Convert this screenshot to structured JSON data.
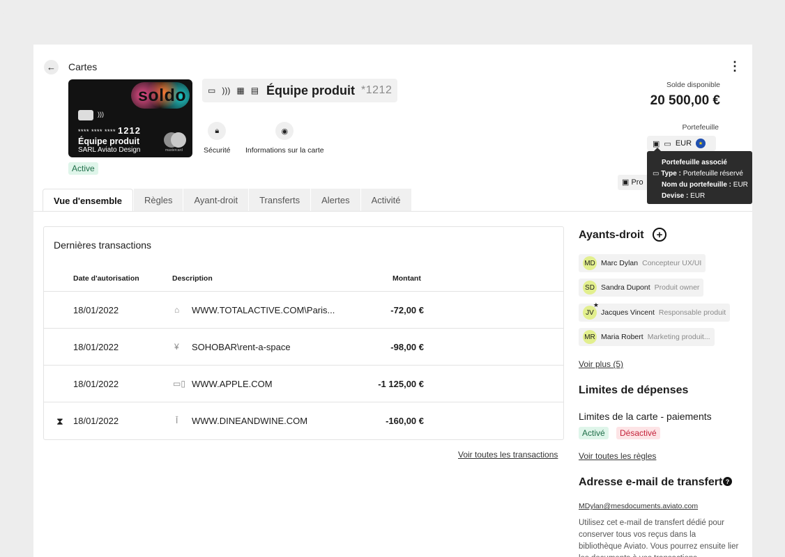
{
  "header": {
    "back_label": "←",
    "breadcrumb": "Cartes",
    "menu": "⋮"
  },
  "card": {
    "logo": "soldo",
    "number_mask": "**** **** ****",
    "number_last": "1212",
    "name": "Équipe produit",
    "company": "SARL Aviato Design",
    "brand": "mastercard",
    "status": "Active"
  },
  "title": {
    "icons": [
      "card-icon",
      "contactless-icon",
      "building-icon",
      "store-icon"
    ],
    "name": "Équipe produit",
    "suffix": "*1212"
  },
  "actions": [
    {
      "icon": "lock-icon",
      "label": "Sécurité"
    },
    {
      "icon": "eye-icon",
      "label": "Informations sur la carte"
    }
  ],
  "balance": {
    "label": "Solde disponible",
    "value": "20 500,00 €"
  },
  "wallet": {
    "label": "Portefeuille",
    "currency": "EUR"
  },
  "tooltip": {
    "title": "Portefeuille associé",
    "type_label": "Type :",
    "type_value": "Portefeuille réservé",
    "name_label": "Nom du portefeuille :",
    "name_value": "EUR",
    "currency_label": "Devise :",
    "currency_value": "EUR"
  },
  "pro_button": "Pro",
  "tabs": [
    "Vue d'ensemble",
    "Règles",
    "Ayant-droit",
    "Transferts",
    "Alertes",
    "Activité"
  ],
  "transactions": {
    "title": "Dernières transactions",
    "headers": {
      "date": "Date d'autorisation",
      "desc": "Description",
      "amount": "Montant"
    },
    "rows": [
      {
        "pending": false,
        "date": "18/01/2022",
        "icon": "shop-icon",
        "desc": "WWW.TOTALACTIVE.COM\\Paris...",
        "amount": "-72,00 €"
      },
      {
        "pending": false,
        "date": "18/01/2022",
        "icon": "drinks-icon",
        "desc": "SOHOBAR\\rent-a-space",
        "amount": "-98,00 €"
      },
      {
        "pending": false,
        "date": "18/01/2022",
        "icon": "devices-icon",
        "desc": "WWW.APPLE.COM",
        "amount": "-1 125,00 €"
      },
      {
        "pending": true,
        "date": "18/01/2022",
        "icon": "wine-icon",
        "desc": "WWW.DINEANDWINE.COM",
        "amount": "-160,00 €"
      }
    ],
    "see_all": "Voir toutes les transactions"
  },
  "beneficiaries": {
    "title": "Ayants-droit",
    "add": "+",
    "people": [
      {
        "initials": "MD",
        "name": "Marc Dylan",
        "role": "Concepteur UX/UI",
        "star": false
      },
      {
        "initials": "SD",
        "name": "Sandra Dupont",
        "role": "Produit owner",
        "star": false
      },
      {
        "initials": "JV",
        "name": "Jacques Vincent",
        "role": "Responsable produit",
        "star": true
      },
      {
        "initials": "MR",
        "name": "Maria Robert",
        "role": "Marketing produit...",
        "star": false
      }
    ],
    "see_more": "Voir plus (5)"
  },
  "limits": {
    "title": "Limites de dépenses",
    "subtitle": "Limites de la carte - paiements",
    "on": "Activé",
    "off": "Désactivé",
    "see_all": "Voir toutes les règles"
  },
  "transfer_email": {
    "title": "Adresse e-mail de transfert",
    "help": "?",
    "email": "MDylan@mesdocuments.aviato.com",
    "text": "Utilisez cet e-mail de transfert dédié pour conserver tous vos reçus dans la bibliothèque Aviato. Vous pourrez ensuite lier les documents à vos transactions."
  },
  "colors": {
    "accent_active": "#1e6e48",
    "accent_off": "#c4233b",
    "avatar": "#e2ef8e"
  }
}
